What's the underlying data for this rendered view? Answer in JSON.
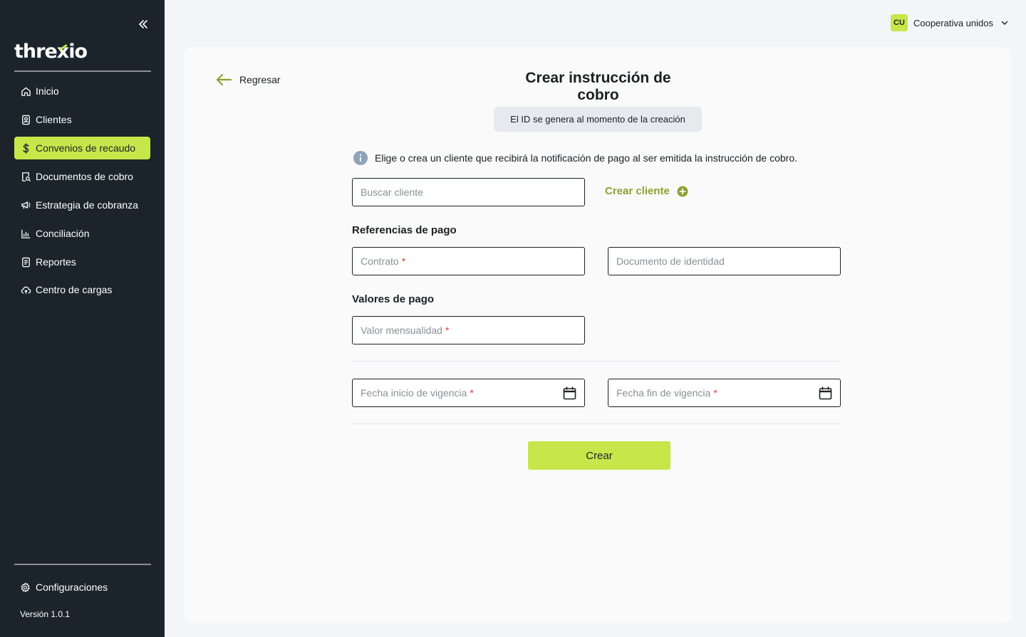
{
  "brand": {
    "logo_pre": "thre",
    "logo_x": "x",
    "logo_post": "io"
  },
  "sidebar": {
    "items": [
      {
        "label": "Inicio",
        "icon": "home-icon"
      },
      {
        "label": "Clientes",
        "icon": "client-card-icon"
      },
      {
        "label": "Convenios de recaudo",
        "icon": "dollar-icon",
        "active": true
      },
      {
        "label": "Documentos de cobro",
        "icon": "document-search-icon"
      },
      {
        "label": "Estrategia de cobranza",
        "icon": "megaphone-icon"
      },
      {
        "label": "Conciliación",
        "icon": "bar-chart-icon"
      },
      {
        "label": "Reportes",
        "icon": "report-icon"
      },
      {
        "label": "Centro de cargas",
        "icon": "cloud-upload-icon"
      }
    ],
    "config_label": "Configuraciones",
    "version": "Versión 1.0.1"
  },
  "user": {
    "initials": "CU",
    "name": "Cooperativa unidos"
  },
  "page": {
    "back_label": "Regresar",
    "title": "Crear instrucción de cobro",
    "id_note": "El ID se genera al momento de la creación",
    "info_text": "Elige o crea un cliente que recibirá la notificación de pago al ser emitida la instrucción de cobro.",
    "search_placeholder": "Buscar cliente",
    "create_client_label": "Crear cliente",
    "section_references": "Referencias de pago",
    "contract_placeholder": "Contrato",
    "id_document_placeholder": "Documento de identidad",
    "section_values": "Valores de pago",
    "monthly_value_placeholder": "Valor mensualidad",
    "start_date_placeholder": "Fecha inicio de vigencia",
    "end_date_placeholder": "Fecha fin de vigencia",
    "required_mark": "*",
    "submit_label": "Crear"
  },
  "colors": {
    "accent": "#c7e64a",
    "sidebar_bg": "#1b242a",
    "link_green": "#8aa233",
    "required": "#e53935"
  }
}
